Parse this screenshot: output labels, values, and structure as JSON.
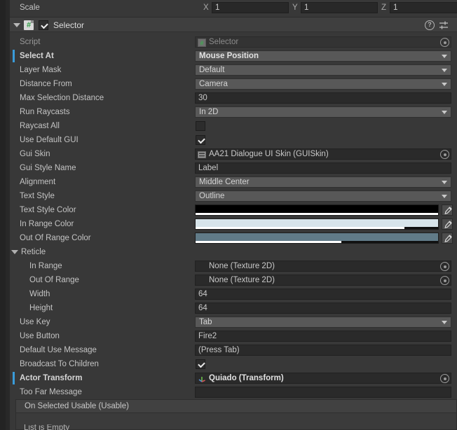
{
  "window": {
    "background": "#383838",
    "accent_override": "#3a9bd9"
  },
  "transform_scale_row": {
    "label": "Scale",
    "axes": [
      {
        "name": "X",
        "value": "1"
      },
      {
        "name": "Y",
        "value": "1"
      },
      {
        "name": "Z",
        "value": "1"
      }
    ]
  },
  "component_header": {
    "title": "Selector",
    "enabled": true,
    "expanded": true,
    "icon": "csharp-script-icon",
    "help_icon": "help-icon",
    "preset_icon": "preset-settings-icon",
    "menu_icon": "kebab-menu-icon"
  },
  "properties": [
    {
      "label": "Script",
      "type": "object",
      "value": "Selector",
      "readonly": true,
      "icon": "csharp-script-icon",
      "override": false
    },
    {
      "label": "Select At",
      "type": "popup",
      "value": "Mouse Position",
      "bold": true,
      "override": true
    },
    {
      "label": "Layer Mask",
      "type": "popup",
      "value": "Default",
      "override": false
    },
    {
      "label": "Distance From",
      "type": "popup",
      "value": "Camera",
      "override": false
    },
    {
      "label": "Max Selection Distance",
      "type": "text",
      "value": "30",
      "override": false
    },
    {
      "label": "Run Raycasts",
      "type": "popup",
      "value": "In 2D",
      "override": false
    },
    {
      "label": "Raycast All",
      "type": "checkbox",
      "value": false,
      "override": false
    },
    {
      "label": "Use Default GUI",
      "type": "checkbox",
      "value": true,
      "override": false
    },
    {
      "label": "Gui Skin",
      "type": "object",
      "value": "AA21 Dialogue UI Skin (GUISkin)",
      "icon": "guiskin-icon",
      "override": false
    },
    {
      "label": "Gui Style Name",
      "type": "text",
      "value": "Label",
      "override": false
    },
    {
      "label": "Alignment",
      "type": "popup",
      "value": "Middle Center",
      "override": false
    },
    {
      "label": "Text Style",
      "type": "popup",
      "value": "Outline",
      "override": false
    },
    {
      "label": "Text Style Color",
      "type": "color",
      "color": "#000000",
      "alpha": 100,
      "override": false
    },
    {
      "label": "In Range Color",
      "type": "color",
      "color": "#d7e4ea",
      "alpha": 86,
      "override": false
    },
    {
      "label": "Out Of Range Color",
      "type": "color",
      "color": "#617b88",
      "alpha": 60,
      "override": false
    },
    {
      "label": "Reticle",
      "type": "foldout",
      "expanded": true,
      "override": false
    },
    {
      "label": "In Range",
      "type": "object",
      "value": "None (Texture 2D)",
      "indent": 1,
      "override": false
    },
    {
      "label": "Out Of Range",
      "type": "object",
      "value": "None (Texture 2D)",
      "indent": 1,
      "override": false
    },
    {
      "label": "Width",
      "type": "text",
      "value": "64",
      "indent": 1,
      "override": false
    },
    {
      "label": "Height",
      "type": "text",
      "value": "64",
      "indent": 1,
      "override": false
    },
    {
      "label": "Use Key",
      "type": "popup",
      "value": "Tab",
      "override": false
    },
    {
      "label": "Use Button",
      "type": "text",
      "value": "Fire2",
      "override": false
    },
    {
      "label": "Default Use Message",
      "type": "text",
      "value": "(Press Tab)",
      "override": false
    },
    {
      "label": "Broadcast To Children",
      "type": "checkbox",
      "value": true,
      "override": false
    },
    {
      "label": "Actor Transform",
      "type": "object",
      "value": "Quiado (Transform)",
      "bold": true,
      "icon": "transform-icon",
      "override": true
    },
    {
      "label": "Too Far Message",
      "type": "text",
      "value": "",
      "override": false
    }
  ],
  "event_section": {
    "header": "On Selected Usable (Usable)"
  }
}
